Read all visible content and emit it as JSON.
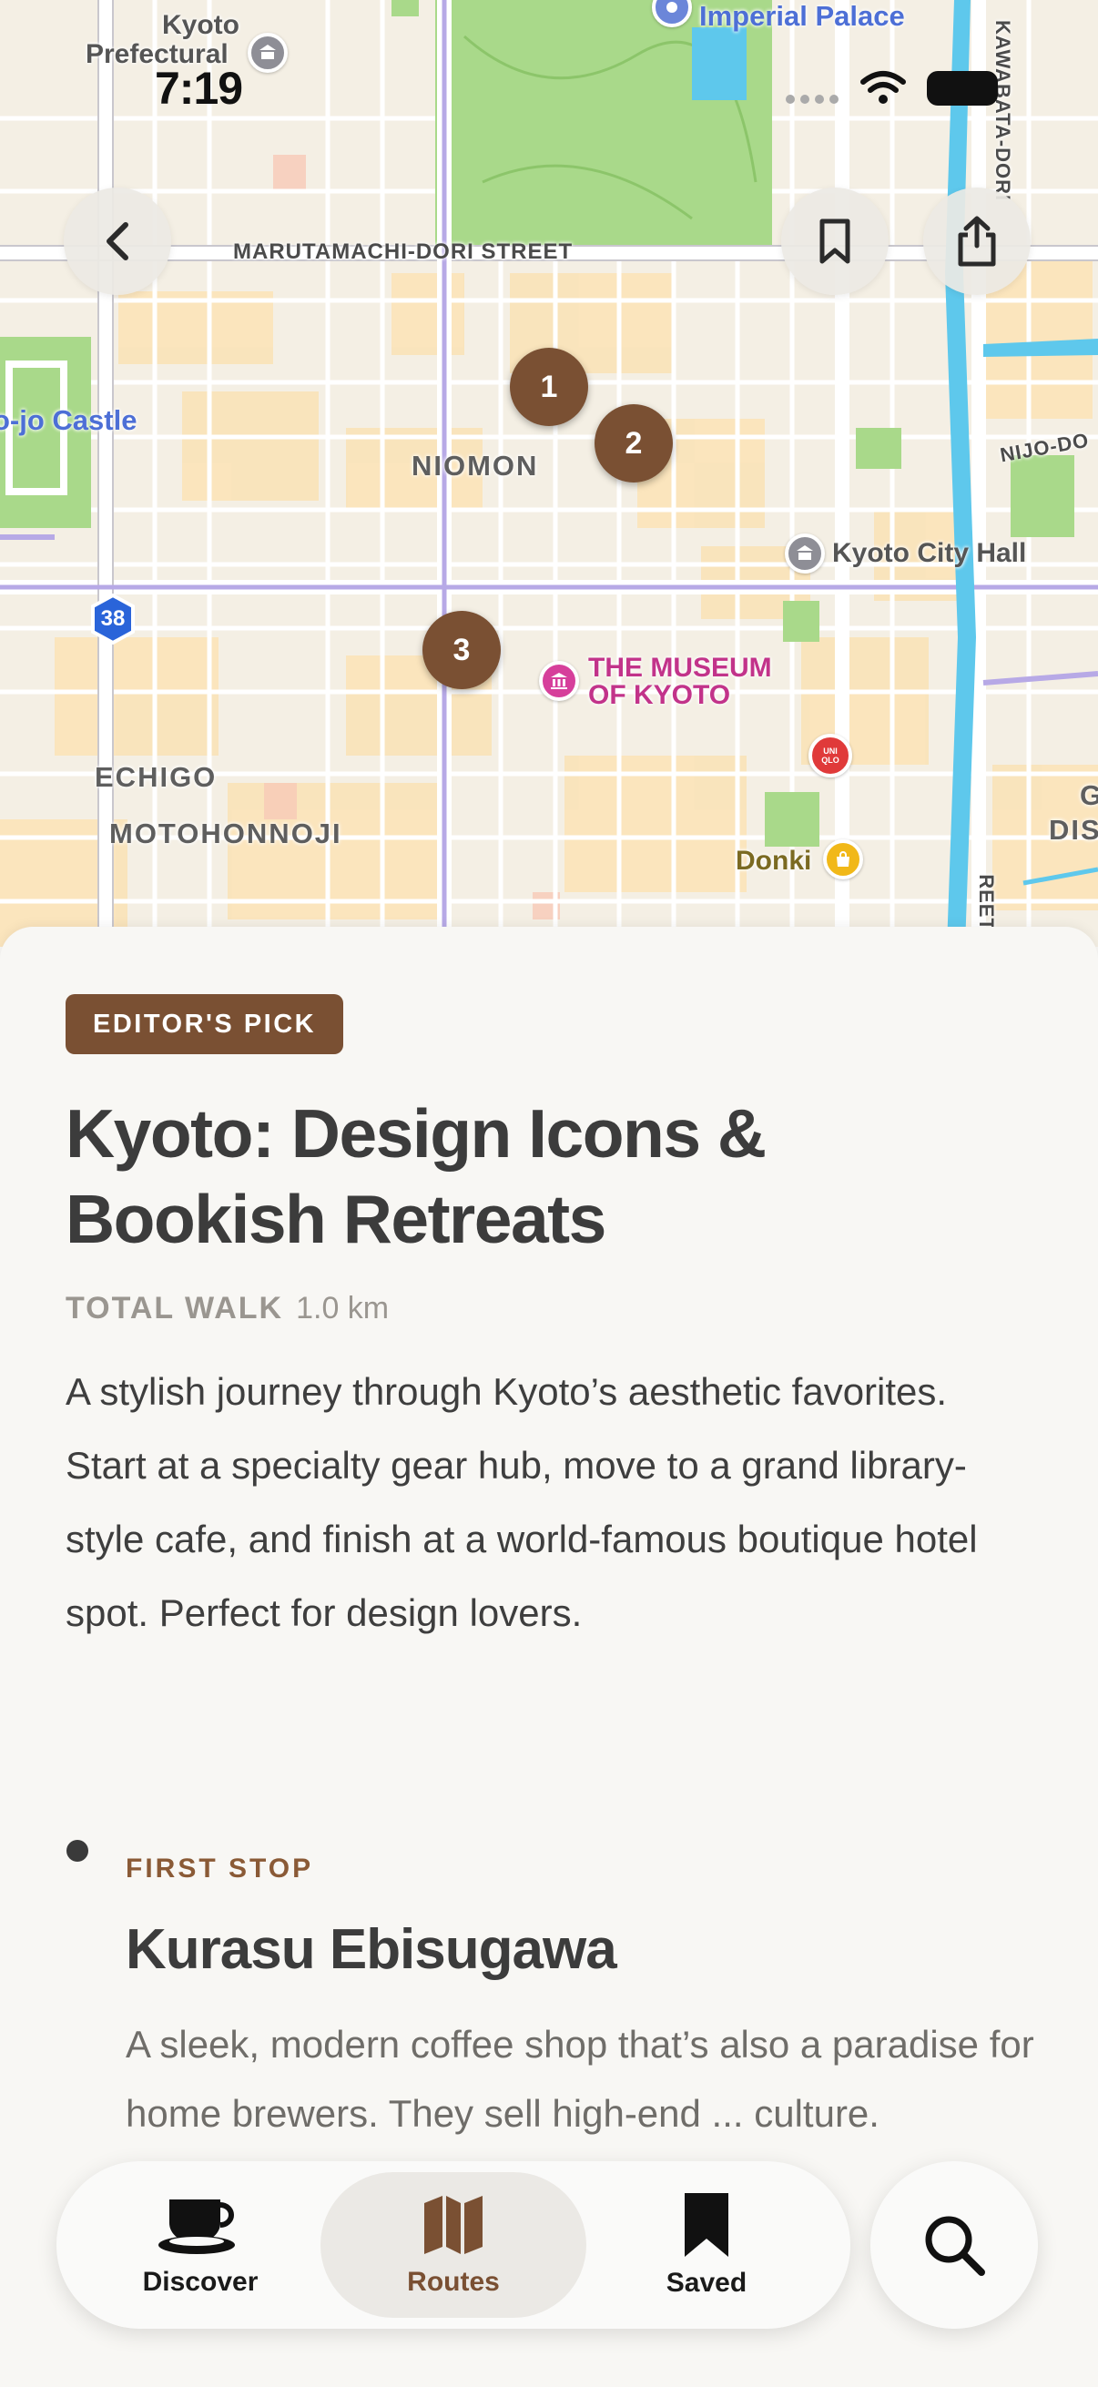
{
  "status_bar": {
    "time": "7:19"
  },
  "map": {
    "streets": {
      "marutamachi": "MARUTAMACHI-DORI STREET",
      "nijo": "NIJO-DO",
      "kawabata": "KAWABATA-DORI",
      "right_street": "REET"
    },
    "districts": {
      "niomon": "NIOMON",
      "echigo": "ECHIGO",
      "motohonnoji": "MOTOHONNOJI",
      "g": "G",
      "dis": "DIS"
    },
    "pois": {
      "prefectural_line1": "Kyoto",
      "prefectural_line2": "Prefectural",
      "imperial_palace": "Imperial Palace",
      "castle": "o-jo Castle",
      "city_hall": "Kyoto City Hall",
      "museum_line1": "THE MUSEUM",
      "museum_line2": "OF KYOTO",
      "uniqlo": "UNI QLO",
      "donki": "Donki"
    },
    "route_shield": "38",
    "markers": [
      "1",
      "2",
      "3"
    ]
  },
  "route": {
    "badge": "EDITOR'S PICK",
    "title": "Kyoto: Design Icons & Bookish Retreats",
    "walk_label": "TOTAL WALK",
    "walk_value": "1.0 km",
    "description": "A stylish journey through Kyoto’s aesthetic favorites. Start at a specialty gear hub, move to a grand library-style cafe, and finish at a world-famous boutique hotel spot. Perfect for design lovers."
  },
  "first_stop": {
    "kicker": "FIRST STOP",
    "name": "Kurasu Ebisugawa",
    "description": "A sleek, modern coffee shop that’s also a paradise for home brewers. They sell high-end ... culture."
  },
  "tabs": [
    {
      "label": "Discover",
      "icon": "coffee-cup-icon"
    },
    {
      "label": "Routes",
      "icon": "map-icon",
      "active": true
    },
    {
      "label": "Saved",
      "icon": "bookmark-icon"
    }
  ],
  "colors": {
    "accent": "#7a5033",
    "sheet_bg": "#f8f7f4",
    "park_green": "#9fd27e",
    "river_blue": "#5ec8ec"
  }
}
